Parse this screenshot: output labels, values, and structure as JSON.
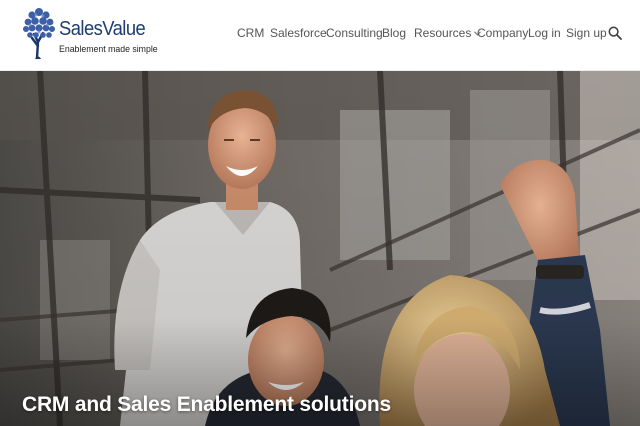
{
  "brand": {
    "name": "SalesValue",
    "tagline": "Enablement made simple",
    "color": "#1f3d6f"
  },
  "nav": {
    "items": [
      {
        "label": "CRM"
      },
      {
        "label": "Salesforce"
      },
      {
        "label": "Consulting"
      },
      {
        "label": "Blog"
      },
      {
        "label": "Resources",
        "has_dropdown": true
      },
      {
        "label": "Company"
      },
      {
        "label": "Log in"
      },
      {
        "label": "Sign up"
      }
    ],
    "search_icon": "search-icon",
    "dropdown_icon": "chevron-down-icon"
  },
  "hero": {
    "headline": "CRM and Sales Enablement solutions"
  }
}
